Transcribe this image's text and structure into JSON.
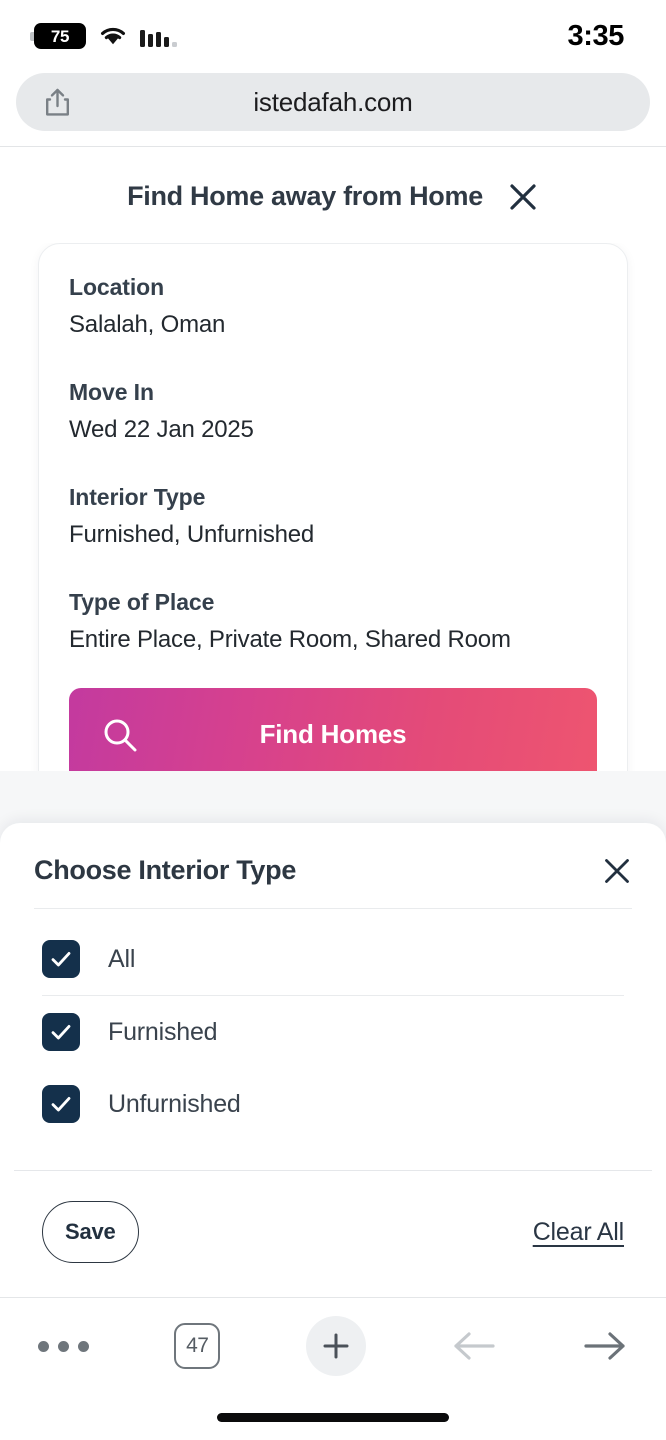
{
  "status_bar": {
    "battery_level": "75",
    "time": "3:35",
    "wifi_icon": "wifi-icon",
    "signal_icon": "signal-bars-icon"
  },
  "browser": {
    "url": "istedafah.com",
    "share_icon": "share-icon",
    "toolbar": {
      "menu_icon": "more-dots-icon",
      "tab_count": "47",
      "new_tab_icon": "plus-icon",
      "back_icon": "arrow-left-icon",
      "forward_icon": "arrow-right-icon"
    }
  },
  "page": {
    "title": "Find Home away from Home",
    "close_icon": "close-x-icon",
    "search_card": {
      "fields": [
        {
          "label": "Location",
          "value": "Salalah, Oman"
        },
        {
          "label": "Move In",
          "value": "Wed 22 Jan 2025"
        },
        {
          "label": "Interior Type",
          "value": "Furnished, Unfurnished"
        },
        {
          "label": "Type of Place",
          "value": "Entire Place, Private Room, Shared Room"
        }
      ],
      "find_button": {
        "label": "Find Homes",
        "icon": "search-icon",
        "gradient_start": "#c33a9f",
        "gradient_end": "#ee5570"
      }
    }
  },
  "sheet": {
    "title": "Choose Interior Type",
    "close_icon": "close-x-icon",
    "options": [
      {
        "label": "All",
        "checked": true
      },
      {
        "label": "Furnished",
        "checked": true
      },
      {
        "label": "Unfurnished",
        "checked": true
      }
    ],
    "save_label": "Save",
    "clear_label": "Clear All",
    "checkbox_color": "#14304b"
  }
}
